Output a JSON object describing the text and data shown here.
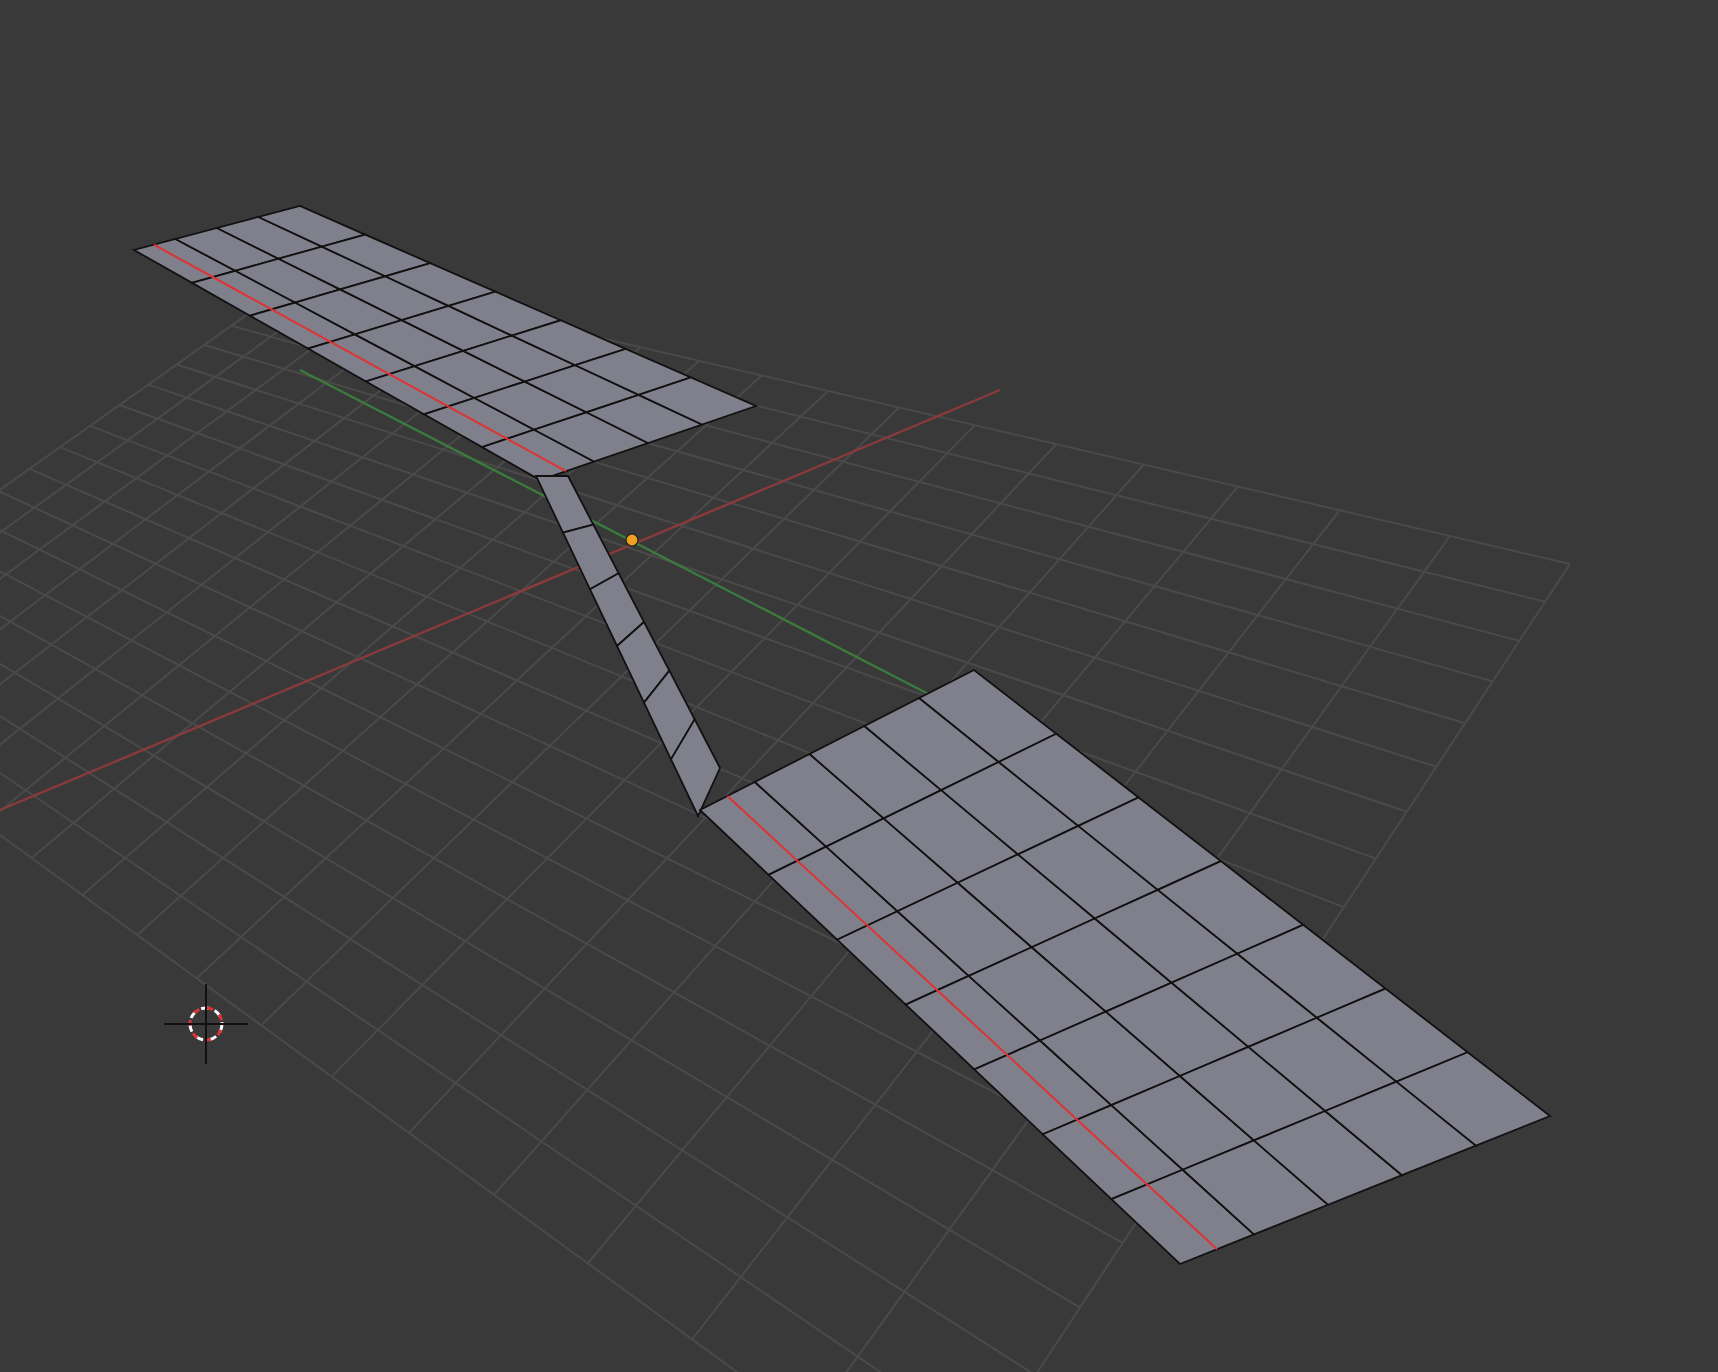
{
  "viewport": {
    "kind": "perspective"
  }
}
